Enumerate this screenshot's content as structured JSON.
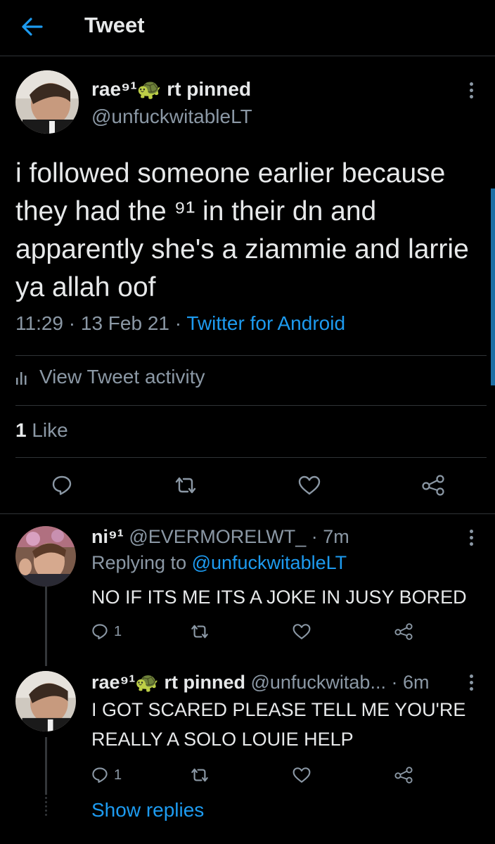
{
  "header": {
    "title": "Tweet"
  },
  "main_tweet": {
    "display_name": "rae⁹¹🐢 rt pinned",
    "handle": "@unfuckwitableLT",
    "text": "i followed someone earlier because they had the ⁹¹ in their dn and apparently she's a ziammie and larrie ya allah oof",
    "time": "11:29 · 13 Feb 21 · ",
    "source": "Twitter for Android",
    "activity_label": "View Tweet activity",
    "like_count": "1",
    "like_label": " Like"
  },
  "replies": [
    {
      "display_name": "ni⁹¹",
      "handle_time": " @EVERMORELWT_ · 7m",
      "replying_prefix": "Replying to ",
      "replying_to": "@unfuckwitableLT",
      "text": "NO IF ITS ME ITS A JOKE IN JUSY BORED",
      "reply_count": "1"
    },
    {
      "display_name": "rae⁹¹🐢 rt pinned",
      "handle_time": " @unfuckwitab... · 6m",
      "text": "I GOT SCARED PLEASE TELL ME YOU'RE REALLY A SOLO LOUIE HELP",
      "reply_count": "1"
    }
  ],
  "show_replies": "Show replies",
  "colors": {
    "accent": "#1d9bf0",
    "muted": "#8b98a5",
    "text": "#e7e9ea",
    "border": "#2f3336"
  }
}
